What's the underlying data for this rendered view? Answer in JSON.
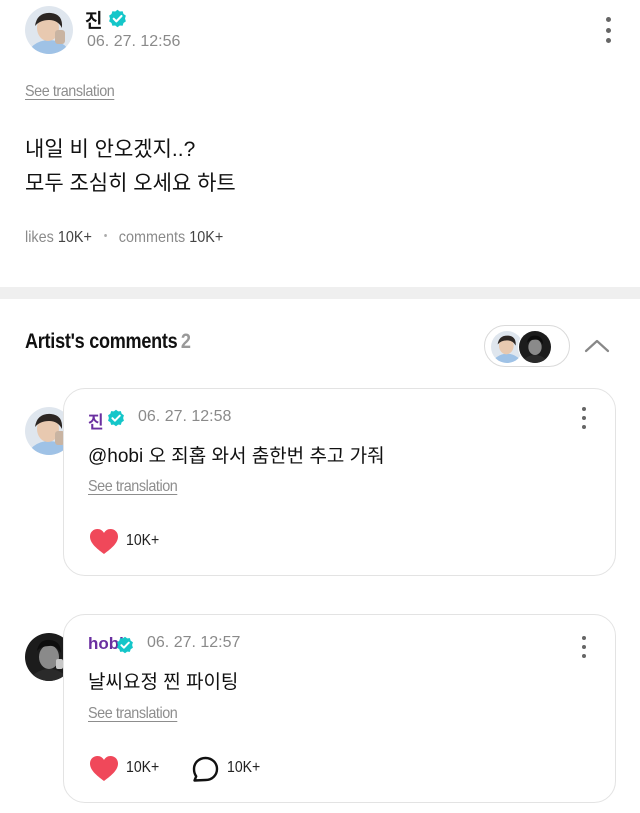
{
  "post": {
    "author": "진",
    "timestamp": "06. 27. 12:56",
    "see_translation": "See translation",
    "body_line1": "내일 비 안오겠지..?",
    "body_line2": "모두 조심히 오세요 하트",
    "likes_label": "likes",
    "likes_value": "10K+",
    "comments_label": "comments",
    "comments_value": "10K+"
  },
  "artist_comments": {
    "title": "Artist's comments",
    "count": "2"
  },
  "comments": [
    {
      "author": "진",
      "timestamp": "06. 27. 12:58",
      "text": "@hobi 오 죄홉 와서 춤한번 추고 가줘",
      "see_translation": "See translation",
      "likes": "10K+"
    },
    {
      "author": "hobi",
      "timestamp": "06. 27. 12:57",
      "text": "날씨요정 찐 파이팅",
      "see_translation": "See translation",
      "likes": "10K+",
      "replies": "10K+"
    }
  ],
  "colors": {
    "verified": "#14c6c9",
    "heart": "#f0485a",
    "author_purple": "#6a2fa0",
    "divider": "#efefef"
  },
  "icons": [
    "verified-badge-icon",
    "more-options-icon",
    "chevron-up-icon",
    "heart-icon",
    "comment-bubble-icon"
  ]
}
